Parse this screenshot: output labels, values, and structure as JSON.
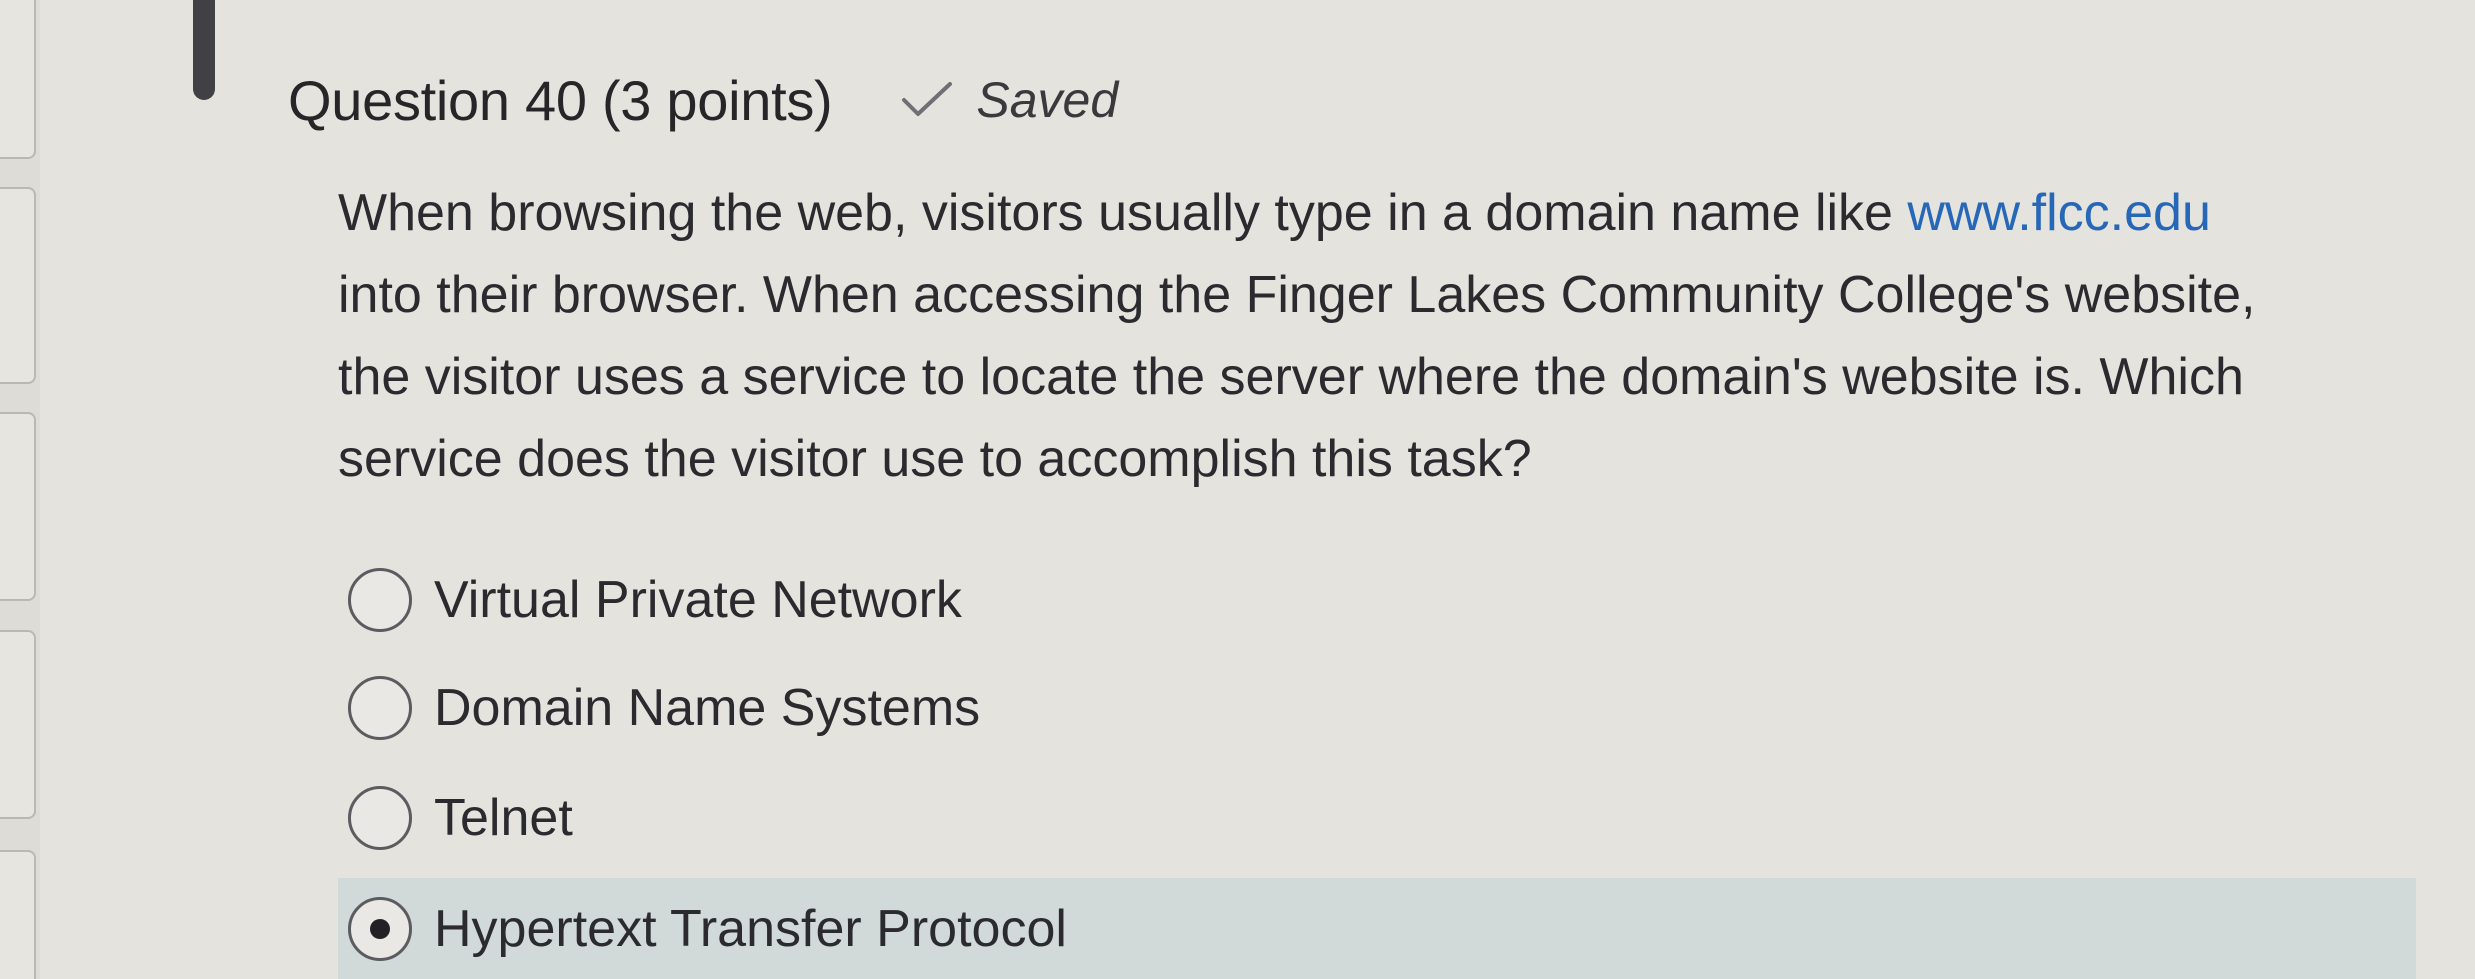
{
  "question": {
    "title": "Question 40 (3 points)",
    "status_icon": "check-icon",
    "status_text": "Saved",
    "text_lines": [
      {
        "before": "When browsing the web, visitors usually type in a domain name like ",
        "link": "www.flcc.edu",
        "after": ""
      },
      {
        "before": "into their browser. When accessing the Finger Lakes Community College's website,",
        "link": "",
        "after": ""
      },
      {
        "before": "the visitor uses a service to locate the server where the domain's website is. Which",
        "link": "",
        "after": ""
      },
      {
        "before": "service does the visitor use to accomplish this task?",
        "link": "",
        "after": ""
      }
    ]
  },
  "options": [
    {
      "label": "Virtual Private Network",
      "selected": false
    },
    {
      "label": "Domain Name Systems",
      "selected": false
    },
    {
      "label": "Telnet",
      "selected": false
    },
    {
      "label": "Hypertext Transfer Protocol",
      "selected": true
    }
  ],
  "colors": {
    "background": "#e4e3de",
    "link": "#2767b8",
    "selected_row": "#d1d9d9"
  }
}
